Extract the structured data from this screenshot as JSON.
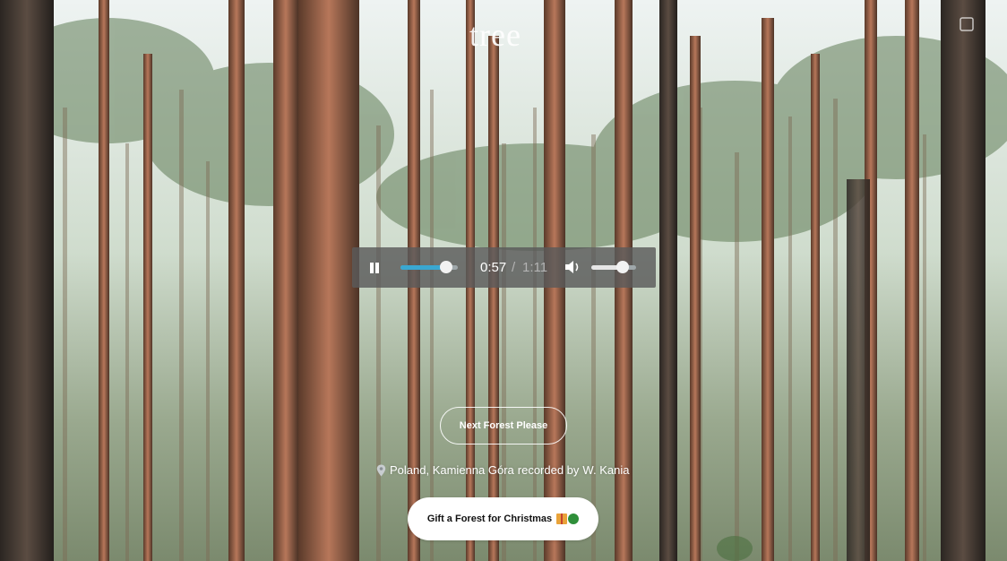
{
  "brand": {
    "logo": "tree"
  },
  "player": {
    "state": "playing",
    "current_time": "0:57",
    "separator": "/",
    "total_time": "1:11",
    "progress": 0.8,
    "volume": 0.7,
    "accent_color": "#3aa7d1"
  },
  "actions": {
    "next_forest_label": "Next Forest Please",
    "gift_label": "Gift a Forest for Christmas"
  },
  "recording": {
    "place": "Poland, Kamienna Góra",
    "recorded_by_label": "recorded by",
    "author": "W. Kania"
  },
  "icons": [
    "pause-icon",
    "volume-icon",
    "location-pin-icon",
    "gift-icon",
    "tree-emoji-icon",
    "corner-menu-icon"
  ]
}
